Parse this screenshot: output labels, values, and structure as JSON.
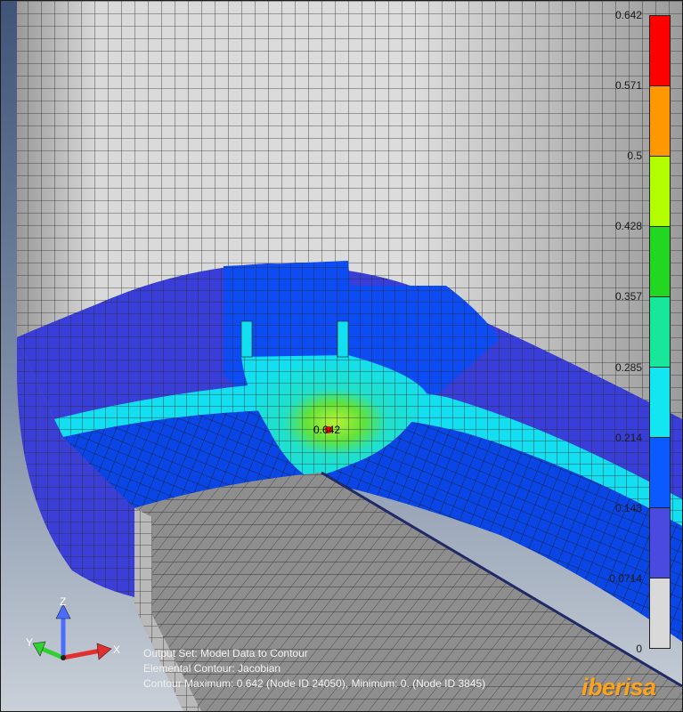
{
  "legend": {
    "labels": [
      "0.642",
      "0.571",
      "0.5",
      "0.428",
      "0.357",
      "0.285",
      "0.214",
      "0.143",
      "0.0714",
      "0"
    ],
    "colors": [
      "#ff0000",
      "#ff9800",
      "#b3ff00",
      "#22d622",
      "#18e69a",
      "#12e6f0",
      "#0a5aff",
      "#4a4ae0",
      "#d9d9d9"
    ]
  },
  "peak_label": "0.642",
  "info": {
    "line1": "Output Set: Model Data to Contour",
    "line2": "Elemental Contour: Jacobian",
    "line3": "Contour Maximum: 0.642 (Node ID 24050), Minimum: 0. (Node ID 3845)"
  },
  "axes": {
    "x": "X",
    "y": "Y",
    "z": "Z"
  },
  "brand": "iberisa",
  "colors": {
    "background": "#55688a",
    "mesh_gray": "#d0d0d0",
    "mesh_gray_dark": "#8c8c8c",
    "mesh_blue": "#3c3cd8",
    "mesh_royal": "#0a4af0",
    "mesh_cyan": "#12e0f0",
    "mesh_green": "#30e030",
    "mesh_lime": "#b0f030",
    "peak_red": "#ff0000",
    "axis_z": "#4a6cff",
    "axis_x": "#e03030",
    "axis_y": "#30d030"
  }
}
